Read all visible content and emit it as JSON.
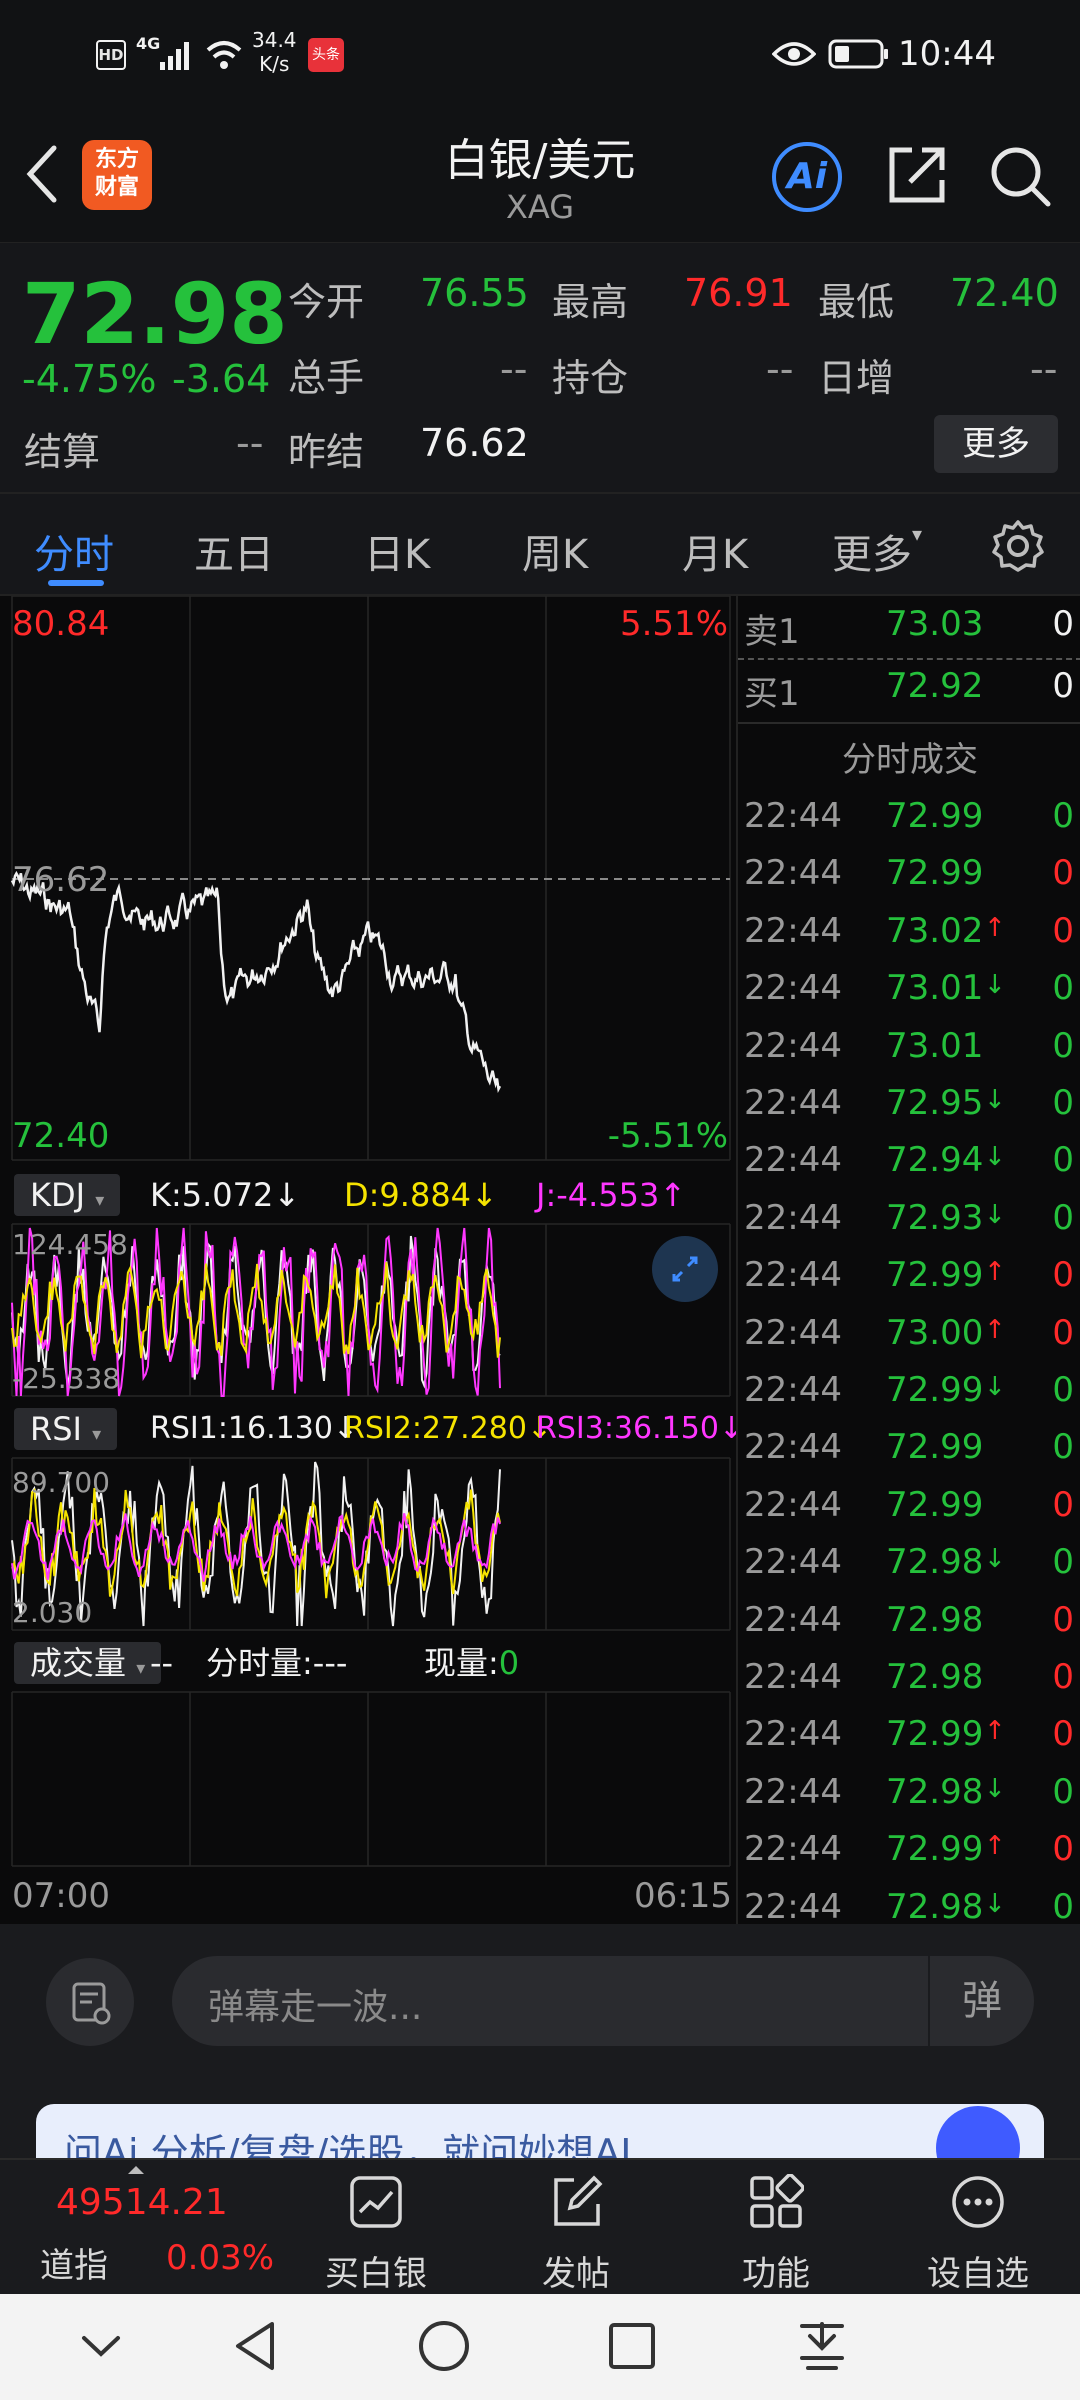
{
  "status_bar": {
    "network_type": "4G",
    "speed_value": "34.4",
    "speed_unit": "K/s",
    "toutiao_badge": "头条",
    "time": "10:44"
  },
  "header": {
    "logo_line1": "东方",
    "logo_line2": "财富",
    "title": "白银/美元",
    "code": "XAG",
    "ai_label": "Ai"
  },
  "quote": {
    "price": "72.98",
    "change_pct": "-4.75%",
    "change": "-3.64",
    "settle_label": "结算",
    "settle_value": "--",
    "open_label": "今开",
    "open_value": "76.55",
    "high_label": "最高",
    "high_value": "76.91",
    "low_label": "最低",
    "low_value": "72.40",
    "volume_label": "总手",
    "volume_value": "--",
    "oi_label": "持仓",
    "oi_value": "--",
    "daily_inc_label": "日增",
    "daily_inc_value": "--",
    "prev_settle_label": "昨结",
    "prev_settle_value": "76.62",
    "more_button": "更多"
  },
  "tabs": {
    "items": [
      "分时",
      "五日",
      "日K",
      "周K",
      "月K",
      "更多"
    ],
    "active": "分时"
  },
  "intraday": {
    "top_price": "80.84",
    "top_pct": "5.51%",
    "ref_price": "76.62",
    "bottom_price": "72.40",
    "bottom_pct": "-5.51%",
    "start_time": "07:00",
    "end_time": "06:15"
  },
  "kdj": {
    "name": "KDJ",
    "k": "K:5.072",
    "d": "D:9.884",
    "j": "J:-4.553",
    "max": "124.458",
    "min": "-25.338"
  },
  "rsi": {
    "name": "RSI",
    "rsi1": "RSI1:16.130",
    "rsi2": "RSI2:27.280",
    "rsi3": "RSI3:36.150",
    "max": "89.700",
    "min": "2.030"
  },
  "volume": {
    "name": "成交量",
    "value": "--",
    "minute_vol": "分时量:---",
    "current_vol_label": "现量:",
    "current_vol_value": "0"
  },
  "order_book": {
    "sell_label": "卖1",
    "sell_price": "73.03",
    "sell_qty": "0",
    "buy_label": "买1",
    "buy_price": "72.92",
    "buy_qty": "0",
    "trades_title": "分时成交"
  },
  "trades": [
    {
      "time": "22:44",
      "price": "72.99",
      "arrow": "",
      "qty": "0",
      "qty_color": "green"
    },
    {
      "time": "22:44",
      "price": "72.99",
      "arrow": "",
      "qty": "0",
      "qty_color": "red"
    },
    {
      "time": "22:44",
      "price": "73.02",
      "arrow": "↑",
      "qty": "0",
      "qty_color": "red"
    },
    {
      "time": "22:44",
      "price": "73.01",
      "arrow": "↓",
      "qty": "0",
      "qty_color": "green"
    },
    {
      "time": "22:44",
      "price": "73.01",
      "arrow": "",
      "qty": "0",
      "qty_color": "green"
    },
    {
      "time": "22:44",
      "price": "72.95",
      "arrow": "↓",
      "qty": "0",
      "qty_color": "green"
    },
    {
      "time": "22:44",
      "price": "72.94",
      "arrow": "↓",
      "qty": "0",
      "qty_color": "green"
    },
    {
      "time": "22:44",
      "price": "72.93",
      "arrow": "↓",
      "qty": "0",
      "qty_color": "green"
    },
    {
      "time": "22:44",
      "price": "72.99",
      "arrow": "↑",
      "qty": "0",
      "qty_color": "red"
    },
    {
      "time": "22:44",
      "price": "73.00",
      "arrow": "↑",
      "qty": "0",
      "qty_color": "red"
    },
    {
      "time": "22:44",
      "price": "72.99",
      "arrow": "↓",
      "qty": "0",
      "qty_color": "green"
    },
    {
      "time": "22:44",
      "price": "72.99",
      "arrow": "",
      "qty": "0",
      "qty_color": "green"
    },
    {
      "time": "22:44",
      "price": "72.99",
      "arrow": "",
      "qty": "0",
      "qty_color": "red"
    },
    {
      "time": "22:44",
      "price": "72.98",
      "arrow": "↓",
      "qty": "0",
      "qty_color": "green"
    },
    {
      "time": "22:44",
      "price": "72.98",
      "arrow": "",
      "qty": "0",
      "qty_color": "red"
    },
    {
      "time": "22:44",
      "price": "72.98",
      "arrow": "",
      "qty": "0",
      "qty_color": "red"
    },
    {
      "time": "22:44",
      "price": "72.99",
      "arrow": "↑",
      "qty": "0",
      "qty_color": "red"
    },
    {
      "time": "22:44",
      "price": "72.98",
      "arrow": "↓",
      "qty": "0",
      "qty_color": "green"
    },
    {
      "time": "22:44",
      "price": "72.99",
      "arrow": "↑",
      "qty": "0",
      "qty_color": "red"
    },
    {
      "time": "22:44",
      "price": "72.98",
      "arrow": "↓",
      "qty": "0",
      "qty_color": "green"
    }
  ],
  "comment_bar": {
    "placeholder": "弹幕走一波...",
    "danmu_label": "弹"
  },
  "banner": {
    "text": "问Ai  分析/复盘/选股，就问妙想AI"
  },
  "bottom_nav": {
    "index_value": "49514.21",
    "index_label": "道指",
    "index_change": "0.03%",
    "buy_label": "买白银",
    "post_label": "发帖",
    "func_label": "功能",
    "watch_label": "设自选"
  },
  "colors": {
    "up": "#ff2a2a",
    "down": "#25c13c",
    "accent": "#3f8cff",
    "kdj_k": "#f2f2f2",
    "kdj_d": "#f5e300",
    "kdj_j": "#ff37ff"
  }
}
